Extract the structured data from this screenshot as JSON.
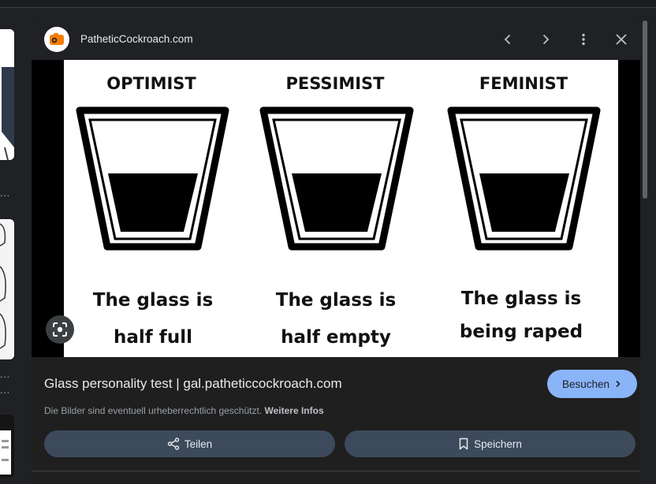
{
  "source": {
    "site_name": "PatheticCockroach.com",
    "favicon": "camera-icon",
    "favicon_color": "#f57c00"
  },
  "header_controls": {
    "prev": "chevron-left-icon",
    "next": "chevron-right-icon",
    "more": "more-vert-icon",
    "close": "close-icon"
  },
  "image": {
    "columns": [
      {
        "heading": "OPTIMIST",
        "line1": "The glass is",
        "line2": "half full"
      },
      {
        "heading": "PESSIMIST",
        "line1": "The glass is",
        "line2": "half empty"
      },
      {
        "heading": "FEMINIST",
        "line1": "The glass is",
        "line2": "being raped"
      }
    ]
  },
  "result": {
    "title": "Glass personality test | gal.patheticcockroach.com",
    "visit_label": "Besuchen",
    "copyright_text": "Die Bilder sind eventuell urheberrechtlich geschützt.",
    "more_info": "Weitere Infos"
  },
  "actions": {
    "share_label": "Teilen",
    "save_label": "Speichern"
  },
  "left_strip": {
    "ellipsis": "..."
  },
  "colors": {
    "accent": "#8ab4f8",
    "background": "#202124",
    "action_button": "#3c4a5c"
  }
}
